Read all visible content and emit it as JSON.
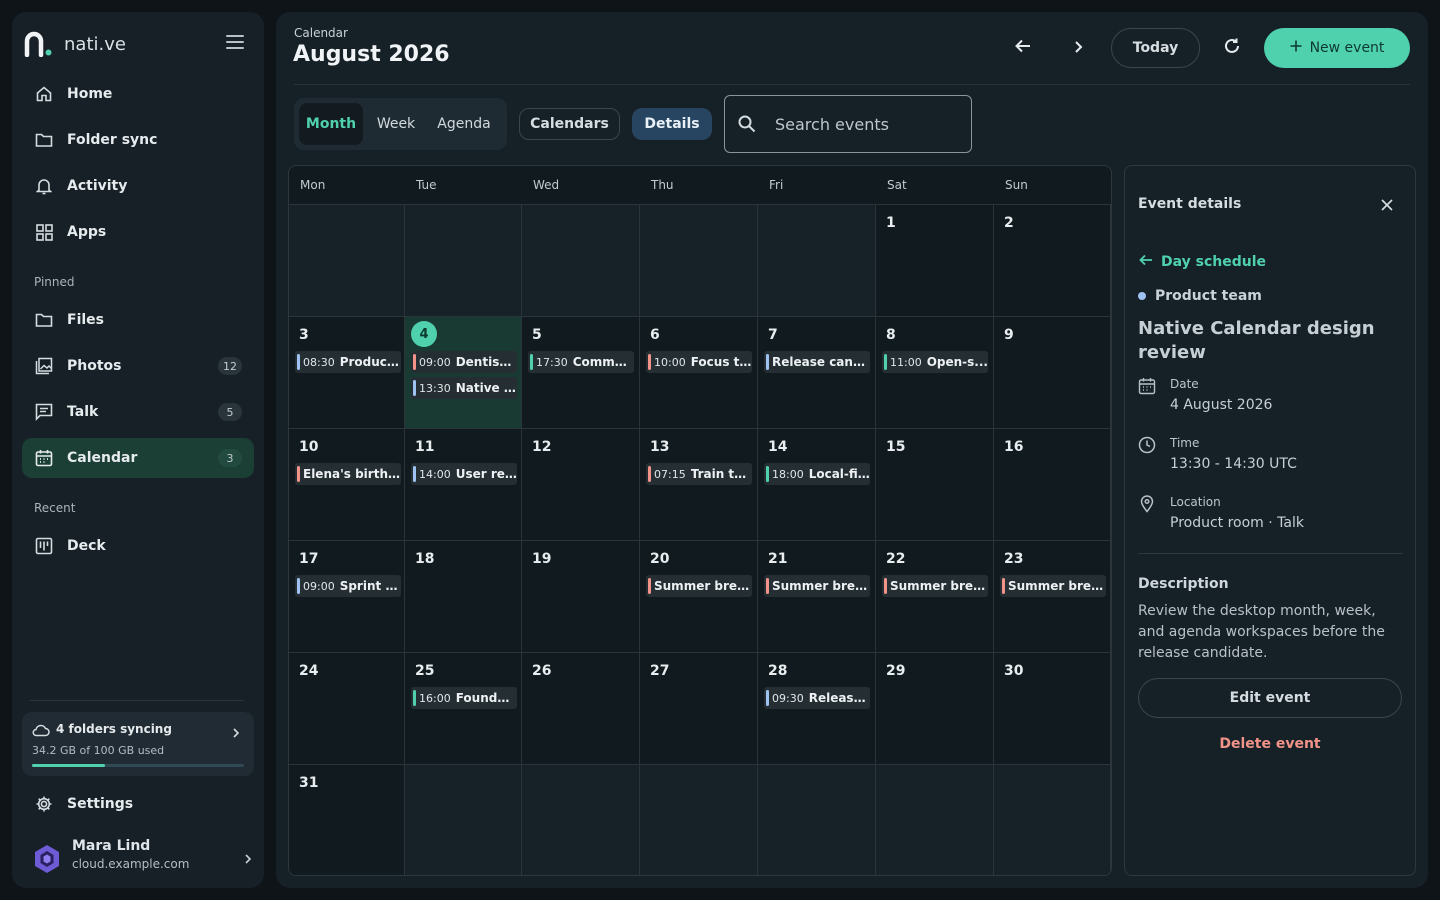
{
  "app": {
    "name": "nati.ve"
  },
  "sidebar": {
    "nav": [
      {
        "label": "Home"
      },
      {
        "label": "Folder sync"
      },
      {
        "label": "Activity"
      },
      {
        "label": "Apps"
      }
    ],
    "pinned_label": "Pinned",
    "pinned": [
      {
        "label": "Files",
        "count": ""
      },
      {
        "label": "Photos",
        "count": "12"
      },
      {
        "label": "Talk",
        "count": "5"
      },
      {
        "label": "Calendar",
        "count": "3"
      }
    ],
    "recent_label": "Recent",
    "recent": [
      {
        "label": "Deck"
      }
    ],
    "sync": {
      "title": "4 folders syncing",
      "usage": "34.2 GB of 100 GB used",
      "used_fraction": 0.342
    },
    "settings_label": "Settings",
    "user": {
      "name": "Mara Lind",
      "server": "cloud.example.com"
    }
  },
  "header": {
    "breadcrumb": "Calendar",
    "title": "August 2026",
    "today_label": "Today",
    "new_event_label": "New event"
  },
  "toolbar": {
    "views": [
      "Month",
      "Week",
      "Agenda"
    ],
    "active_view": "Month",
    "calendars_label": "Calendars",
    "details_label": "Details",
    "search_placeholder": "Search events"
  },
  "calendar": {
    "weekdays": [
      "Mon",
      "Tue",
      "Wed",
      "Thu",
      "Fri",
      "Sat",
      "Sun"
    ],
    "today": 4,
    "weeks": [
      [
        null,
        null,
        null,
        null,
        null,
        1,
        2
      ],
      [
        3,
        4,
        5,
        6,
        7,
        8,
        9
      ],
      [
        10,
        11,
        12,
        13,
        14,
        15,
        16
      ],
      [
        17,
        18,
        19,
        20,
        21,
        22,
        23
      ],
      [
        24,
        25,
        26,
        27,
        28,
        29,
        30
      ],
      [
        31,
        null,
        null,
        null,
        null,
        null,
        null
      ]
    ],
    "events": [
      {
        "day": 3,
        "time": "08:30",
        "text": "Product...",
        "color": "#9ec3f2"
      },
      {
        "day": 4,
        "time": "09:00",
        "text": "Dentist ...",
        "color": "#f2938a"
      },
      {
        "day": 4,
        "time": "13:30",
        "text": "Native ...",
        "color": "#9ec3f2"
      },
      {
        "day": 5,
        "time": "17:30",
        "text": "Commu...",
        "color": "#4fd1ae"
      },
      {
        "day": 6,
        "time": "10:00",
        "text": "Focus ti...",
        "color": "#f2938a"
      },
      {
        "day": 7,
        "time": "",
        "text": "Release candi...",
        "color": "#9ec3f2"
      },
      {
        "day": 8,
        "time": "11:00",
        "text": "Open-s...",
        "color": "#4fd1ae"
      },
      {
        "day": 10,
        "time": "",
        "text": "Elena's birthd...",
        "color": "#f2938a"
      },
      {
        "day": 11,
        "time": "14:00",
        "text": "User re...",
        "color": "#9ec3f2"
      },
      {
        "day": 13,
        "time": "07:15",
        "text": "Train to...",
        "color": "#f2938a"
      },
      {
        "day": 14,
        "time": "18:00",
        "text": "Local-fir...",
        "color": "#4fd1ae"
      },
      {
        "day": 17,
        "time": "09:00",
        "text": "Sprint p...",
        "color": "#9ec3f2"
      },
      {
        "day": 20,
        "time": "",
        "text": "Summer break",
        "color": "#f2938a"
      },
      {
        "day": 21,
        "time": "",
        "text": "Summer break",
        "color": "#f2938a"
      },
      {
        "day": 22,
        "time": "",
        "text": "Summer break",
        "color": "#f2938a"
      },
      {
        "day": 23,
        "time": "",
        "text": "Summer break",
        "color": "#f2938a"
      },
      {
        "day": 25,
        "time": "16:00",
        "text": "Founda...",
        "color": "#4fd1ae"
      },
      {
        "day": 28,
        "time": "09:30",
        "text": "Release...",
        "color": "#9ec3f2"
      }
    ]
  },
  "details": {
    "heading": "Event details",
    "back_label": "Day schedule",
    "calendar_name": "Product team",
    "calendar_color": "#9ec3f2",
    "title": "Native Calendar design review",
    "date_label": "Date",
    "date_value": "4 August 2026",
    "time_label": "Time",
    "time_value": "13:30 - 14:30 UTC",
    "location_label": "Location",
    "location_value": "Product room · Talk",
    "description_label": "Description",
    "description": "Review the desktop month, week, and agenda workspaces before the release candidate.",
    "edit_label": "Edit event",
    "delete_label": "Delete event"
  },
  "colors": {
    "accent": "#4fd1ae",
    "danger": "#f2938a",
    "info": "#9ec3f2"
  }
}
